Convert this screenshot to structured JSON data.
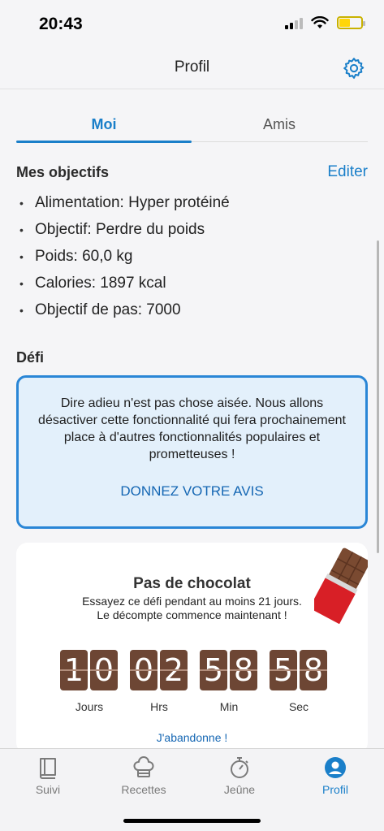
{
  "status": {
    "time": "20:43"
  },
  "nav": {
    "title": "Profil"
  },
  "tabs": {
    "me": "Moi",
    "friends": "Amis"
  },
  "goals": {
    "heading": "Mes objectifs",
    "edit": "Editer",
    "items": [
      "Alimentation: Hyper protéiné",
      "Objectif: Perdre du poids",
      "Poids: 60,0 kg",
      "Calories: 1897 kcal",
      "Objectif de pas: 7000"
    ]
  },
  "challenge_section": {
    "heading": "Défi"
  },
  "notice": {
    "text": "Dire adieu n'est pas chose aisée. Nous allons désactiver cette fonctionnalité qui fera prochainement place à d'autres fonctionnalités populaires et prometteuses !",
    "link": "DONNEZ VOTRE AVIS"
  },
  "challenge": {
    "title": "Pas de chocolat",
    "description": "Essayez ce défi pendant au moins 21 jours. Le décompte commence maintenant !",
    "countdown": [
      {
        "digits": [
          "1",
          "0"
        ],
        "label": "Jours"
      },
      {
        "digits": [
          "0",
          "2"
        ],
        "label": "Hrs"
      },
      {
        "digits": [
          "5",
          "8"
        ],
        "label": "Min"
      },
      {
        "digits": [
          "5",
          "8"
        ],
        "label": "Sec"
      }
    ],
    "abandon": "J'abandonne !"
  },
  "tabbar": [
    {
      "label": "Suivi",
      "icon": "book-icon"
    },
    {
      "label": "Recettes",
      "icon": "chef-hat-icon"
    },
    {
      "label": "Jeûne",
      "icon": "stopwatch-icon"
    },
    {
      "label": "Profil",
      "icon": "profile-icon"
    }
  ],
  "colors": {
    "accent": "#1a7fc9",
    "chocolate": "#6d4634",
    "notice_bg": "#e3f0fb"
  }
}
